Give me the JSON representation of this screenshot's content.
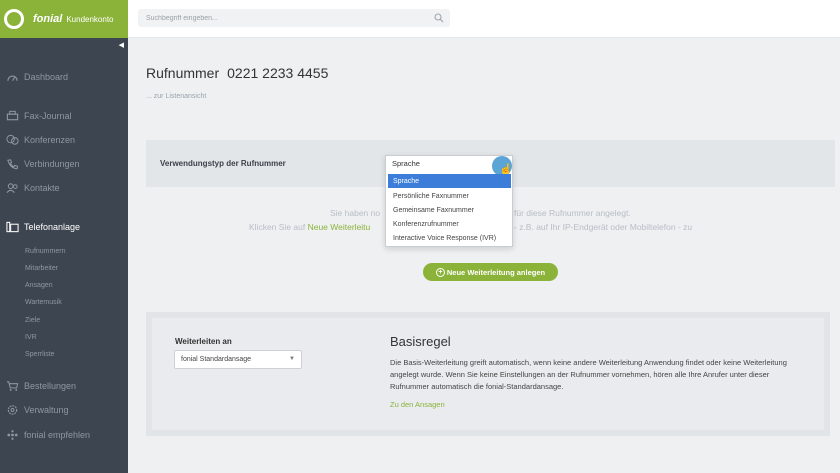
{
  "brand": {
    "name": "fonial",
    "sub": "Kundenkonto"
  },
  "search": {
    "placeholder": "Suchbegriff eingeben..."
  },
  "sidebar": {
    "items": [
      {
        "label": "Dashboard",
        "icon": "dashboard-icon"
      },
      {
        "label": "Fax-Journal",
        "icon": "fax-icon"
      },
      {
        "label": "Konferenzen",
        "icon": "conference-icon"
      },
      {
        "label": "Verbindungen",
        "icon": "phone-icon"
      },
      {
        "label": "Kontakte",
        "icon": "contacts-icon"
      },
      {
        "label": "Telefonanlage",
        "icon": "phone-system-icon",
        "active": true
      },
      {
        "label": "Bestellungen",
        "icon": "cart-icon"
      },
      {
        "label": "Verwaltung",
        "icon": "gear-icon"
      },
      {
        "label": "fonial empfehlen",
        "icon": "share-icon"
      }
    ],
    "subitems": [
      "Rufnummern",
      "Mitarbeiter",
      "Ansagen",
      "Wartemusik",
      "Ziele",
      "IVR",
      "Sperrliste"
    ]
  },
  "page": {
    "title": "Rufnummer",
    "number": "0221 2233 4455",
    "back_link": "... zur Listenansicht"
  },
  "usage": {
    "label": "Verwendungstyp der Rufnummer",
    "selected": "Sprache",
    "options": [
      "Sprache",
      "Persönliche Faxnummer",
      "Gemeinsame Faxnummer",
      "Konferenzrufnummer",
      "Interactive Voice Response (IVR)"
    ]
  },
  "info": {
    "line1_start": "Sie haben no",
    "line1_end": "für diese Rufnummer angelegt.",
    "line2_start": "Klicken Sie auf ",
    "line2_link": "Neue Weiterleitu",
    "line2_end": "- z.B. auf Ihr IP-Endgerät oder Mobiltelefon - zu"
  },
  "new_forward_button": "Neue Weiterleitung anlegen",
  "forward": {
    "label": "Weiterleiten an",
    "selected": "fonial Standardansage"
  },
  "rule": {
    "title": "Basisregel",
    "description": "Die Basis-Weiterleitung greift automatisch, wenn keine andere Weiterleitung Anwendung findet oder keine Weiterleitung angelegt wurde. Wenn Sie keine Einstellungen an der Rufnummer vornehmen, hören alle Ihre Anrufer unter dieser Rufnummer automatisch die fonial-Standardansage.",
    "link": "Zu den Ansagen"
  },
  "colors": {
    "brand_green": "#8bb33a",
    "sidebar": "#3d4650",
    "selection_blue": "#3b7dd8"
  }
}
